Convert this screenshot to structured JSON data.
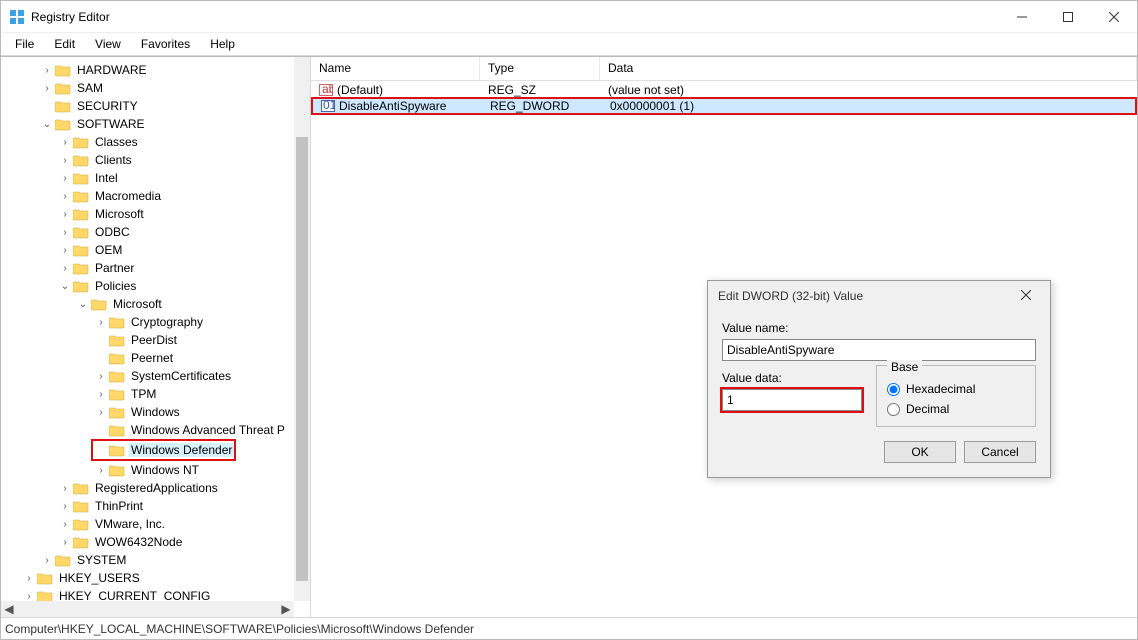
{
  "window": {
    "title": "Registry Editor"
  },
  "menubar": [
    "File",
    "Edit",
    "View",
    "Favorites",
    "Help"
  ],
  "tree": [
    {
      "indent": 40,
      "toggle": ">",
      "label": "HARDWARE"
    },
    {
      "indent": 40,
      "toggle": ">",
      "label": "SAM"
    },
    {
      "indent": 40,
      "toggle": "",
      "label": "SECURITY"
    },
    {
      "indent": 40,
      "toggle": "v",
      "label": "SOFTWARE"
    },
    {
      "indent": 58,
      "toggle": ">",
      "label": "Classes"
    },
    {
      "indent": 58,
      "toggle": ">",
      "label": "Clients"
    },
    {
      "indent": 58,
      "toggle": ">",
      "label": "Intel"
    },
    {
      "indent": 58,
      "toggle": ">",
      "label": "Macromedia"
    },
    {
      "indent": 58,
      "toggle": ">",
      "label": "Microsoft"
    },
    {
      "indent": 58,
      "toggle": ">",
      "label": "ODBC"
    },
    {
      "indent": 58,
      "toggle": ">",
      "label": "OEM"
    },
    {
      "indent": 58,
      "toggle": ">",
      "label": "Partner"
    },
    {
      "indent": 58,
      "toggle": "v",
      "label": "Policies"
    },
    {
      "indent": 76,
      "toggle": "v",
      "label": "Microsoft"
    },
    {
      "indent": 94,
      "toggle": ">",
      "label": "Cryptography"
    },
    {
      "indent": 94,
      "toggle": "",
      "label": "PeerDist"
    },
    {
      "indent": 94,
      "toggle": "",
      "label": "Peernet"
    },
    {
      "indent": 94,
      "toggle": ">",
      "label": "SystemCertificates"
    },
    {
      "indent": 94,
      "toggle": ">",
      "label": "TPM"
    },
    {
      "indent": 94,
      "toggle": ">",
      "label": "Windows"
    },
    {
      "indent": 94,
      "toggle": "",
      "label": "Windows Advanced Threat P"
    },
    {
      "indent": 94,
      "toggle": "",
      "label": "Windows Defender",
      "selected": true,
      "boxed": true
    },
    {
      "indent": 94,
      "toggle": ">",
      "label": "Windows NT"
    },
    {
      "indent": 58,
      "toggle": ">",
      "label": "RegisteredApplications"
    },
    {
      "indent": 58,
      "toggle": ">",
      "label": "ThinPrint"
    },
    {
      "indent": 58,
      "toggle": ">",
      "label": "VMware, Inc."
    },
    {
      "indent": 58,
      "toggle": ">",
      "label": "WOW6432Node"
    },
    {
      "indent": 40,
      "toggle": ">",
      "label": "SYSTEM"
    },
    {
      "indent": 22,
      "toggle": ">",
      "label": "HKEY_USERS"
    },
    {
      "indent": 22,
      "toggle": ">",
      "label": "HKEY_CURRENT_CONFIG"
    }
  ],
  "list": {
    "headers": {
      "name": "Name",
      "type": "Type",
      "data": "Data"
    },
    "rows": [
      {
        "icon": "sz",
        "name": "(Default)",
        "type": "REG_SZ",
        "data": "(value not set)"
      },
      {
        "icon": "dw",
        "name": "DisableAntiSpyware",
        "type": "REG_DWORD",
        "data": "0x00000001 (1)",
        "selected": true,
        "boxed": true
      }
    ]
  },
  "dialog": {
    "title": "Edit DWORD (32-bit) Value",
    "valueNameLabel": "Value name:",
    "valueName": "DisableAntiSpyware",
    "valueDataLabel": "Value data:",
    "valueData": "1",
    "baseLabel": "Base",
    "hex": "Hexadecimal",
    "dec": "Decimal",
    "ok": "OK",
    "cancel": "Cancel"
  },
  "statusbar": "Computer\\HKEY_LOCAL_MACHINE\\SOFTWARE\\Policies\\Microsoft\\Windows Defender"
}
